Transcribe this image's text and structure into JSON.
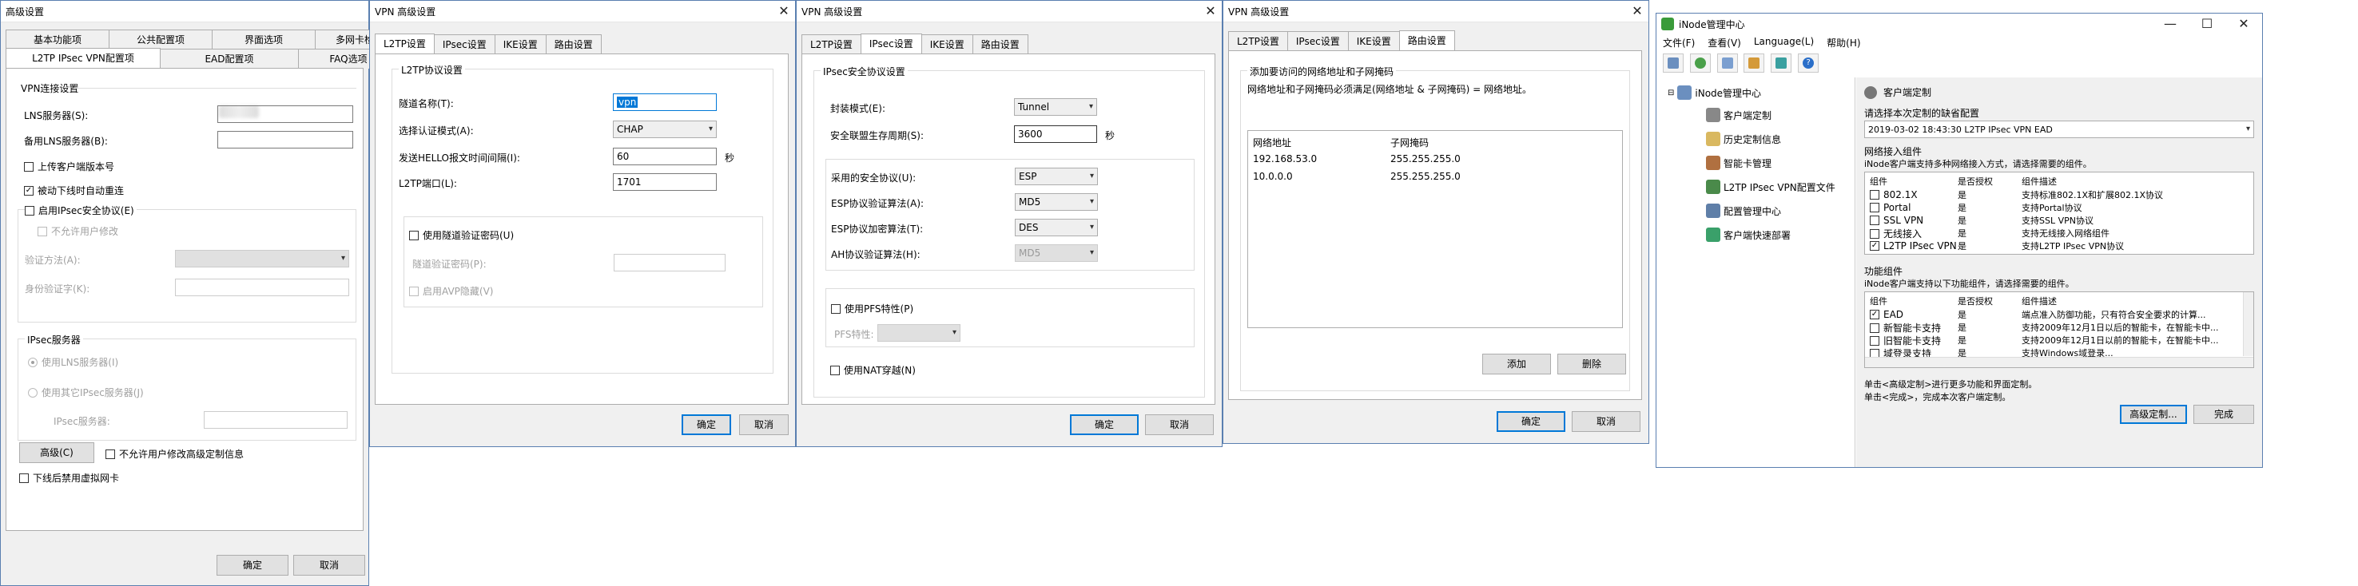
{
  "w1": {
    "title": "高级设置",
    "tabs_row1": [
      "基本功能项",
      "公共配置项",
      "界面选项",
      "多网卡检测"
    ],
    "tabs_row2": [
      "L2TP IPsec VPN配置项",
      "EAD配置项",
      "FAQ选项"
    ],
    "group_conn": "VPN连接设置",
    "lns_label": "LNS服务器(S):",
    "backup_lns_label": "备用LNS服务器(B):",
    "upload_version": "上传客户端版本号",
    "auto_reconnect": "被动下线时自动重连",
    "enable_ipsec": "启用IPsec安全协议(E)",
    "disallow_user_modify": "不允许用户修改",
    "auth_method_label": "验证方法(A):",
    "identity_cert_label": "身份验证字(K):",
    "group_ipsec": "IPsec服务器",
    "use_lns": "使用LNS服务器(I)",
    "use_other_ipsec": "使用其它IPsec服务器(J)",
    "ipsec_server_label": "IPsec服务器:",
    "advanced_btn": "高级(C)",
    "disallow_adv": "不允许用户修改高级定制信息",
    "disable_nic": "下线后禁用虚拟网卡",
    "ok": "确定",
    "cancel": "取消"
  },
  "w2": {
    "title": "VPN 高级设置",
    "tabs": [
      "L2TP设置",
      "IPsec设置",
      "IKE设置",
      "路由设置"
    ],
    "group": "L2TP协议设置",
    "tunnel_name_label": "隧道名称(T):",
    "tunnel_name_value": "vpn",
    "auth_mode_label": "选择认证模式(A):",
    "auth_mode_value": "CHAP",
    "hello_label": "发送HELLO报文时间间隔(I):",
    "hello_value": "60",
    "hello_unit": "秒",
    "port_label": "L2TP端口(L):",
    "port_value": "1701",
    "enable_tunnel_auth": "使用隧道验证密码(U)",
    "tunnel_pwd_label": "隧道验证密码(P):",
    "enable_avp": "启用AVP隐藏(V)",
    "ok": "确定",
    "cancel": "取消"
  },
  "w3": {
    "title": "VPN 高级设置",
    "tabs": [
      "L2TP设置",
      "IPsec设置",
      "IKE设置",
      "路由设置"
    ],
    "group": "IPsec安全协议设置",
    "encap_label": "封装模式(E):",
    "encap_value": "Tunnel",
    "lifetime_label": "安全联盟生存周期(S):",
    "lifetime_value": "3600",
    "lifetime_unit": "秒",
    "proto_label": "采用的安全协议(U):",
    "proto_value": "ESP",
    "esp_auth_label": "ESP协议验证算法(A):",
    "esp_auth_value": "MD5",
    "esp_enc_label": "ESP协议加密算法(T):",
    "esp_enc_value": "DES",
    "ah_auth_label": "AH协议验证算法(H):",
    "ah_auth_value": "MD5",
    "use_pfs": "使用PFS特性(P)",
    "pfs_label": "PFS特性:",
    "use_nat": "使用NAT穿越(N)",
    "ok": "确定",
    "cancel": "取消"
  },
  "w4": {
    "title": "VPN 高级设置",
    "tabs": [
      "L2TP设置",
      "IPsec设置",
      "IKE设置",
      "路由设置"
    ],
    "instr1": "添加要访问的网络地址和子网掩码",
    "instr2": "网络地址和子网掩码必须满足(网络地址 & 子网掩码) = 网络地址。",
    "col_addr": "网络地址",
    "col_mask": "子网掩码",
    "rows": [
      {
        "addr": "192.168.53.0",
        "mask": "255.255.255.0"
      },
      {
        "addr": "10.0.0.0",
        "mask": "255.255.255.0"
      }
    ],
    "add_btn": "添加",
    "delete_btn": "删除",
    "ok": "确定",
    "cancel": "取消"
  },
  "w5": {
    "title": "iNode管理中心",
    "menu": [
      "文件(F)",
      "查看(V)",
      "Language(L)",
      "帮助(H)"
    ],
    "tree_root": "iNode管理中心",
    "tree_items": [
      "客户端定制",
      "历史定制信息",
      "智能卡管理",
      "L2TP IPsec VPN配置文件",
      "配置管理中心",
      "客户端快速部署"
    ],
    "header": "客户端定制",
    "select_label": "请选择本次定制的缺省配置",
    "select_value": "2019-03-02 18:43:30    L2TP IPsec VPN  EAD",
    "net_group": "网络接入组件",
    "net_desc": "iNode客户端支持多种网络接入方式，请选择需要的组件。",
    "col_comp": "组件",
    "col_auth": "是否授权",
    "col_desc": "组件描述",
    "net_rows": [
      {
        "c": "802.1X",
        "a": "是",
        "d": "支持标准802.1X和扩展802.1X协议",
        "checked": false
      },
      {
        "c": "Portal",
        "a": "是",
        "d": "支持Portal协议",
        "checked": false
      },
      {
        "c": "SSL VPN",
        "a": "是",
        "d": "支持SSL VPN协议",
        "checked": false
      },
      {
        "c": "无线接入",
        "a": "是",
        "d": "支持无线接入网络组件",
        "checked": false
      },
      {
        "c": "L2TP IPsec VPN",
        "a": "是",
        "d": "支持L2TP IPsec VPN协议",
        "checked": true
      }
    ],
    "func_group": "功能组件",
    "func_desc": "iNode客户端支持以下功能组件，请选择需要的组件。",
    "func_rows": [
      {
        "c": "EAD",
        "a": "是",
        "d": "端点准入防御功能，只有符合安全要求的计算...",
        "checked": true
      },
      {
        "c": "新智能卡支持",
        "a": "是",
        "d": "支持2009年12月1日以后的智能卡，在智能卡中...",
        "checked": false
      },
      {
        "c": "旧智能卡支持",
        "a": "是",
        "d": "支持2009年12月1日以前的智能卡，在智能卡中...",
        "checked": false
      },
      {
        "c": "域登录支持",
        "a": "是",
        "d": "支持Windows域登录...",
        "checked": false
      }
    ],
    "hint1": "单击<高级定制>进行更多功能和界面定制。",
    "hint2": "单击<完成>，完成本次客户端定制。",
    "adv_btn": "高级定制...",
    "finish_btn": "完成",
    "min": "—",
    "max": "☐",
    "close": "✕"
  },
  "colors": {
    "accent": "#0078d7",
    "border": "#adadad"
  }
}
